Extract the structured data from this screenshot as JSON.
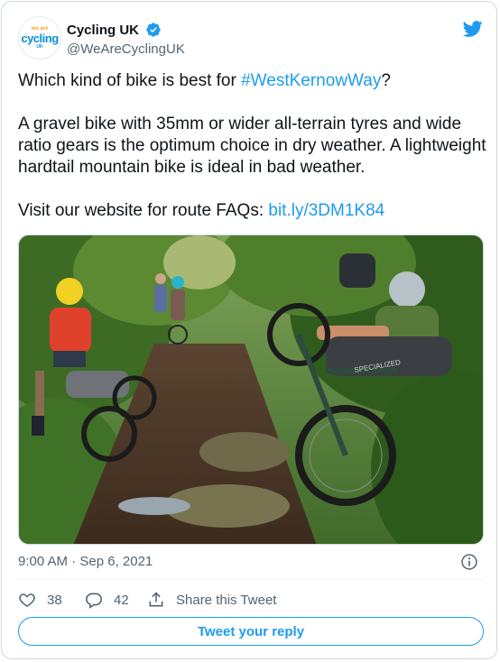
{
  "author": {
    "display_name": "Cycling UK",
    "handle": "@WeAreCyclingUK",
    "avatar": {
      "top": "we are",
      "main": "cycling",
      "bottom": "UK"
    },
    "verified": true
  },
  "tweet": {
    "line1_prefix": "Which kind of bike is best for ",
    "hashtag": "#WestKernowWay",
    "line1_suffix": "?",
    "paragraph2": "A gravel bike with 35mm or wider all-terrain tyres and wide ratio gears is the optimum choice in dry weather. A lightweight hardtail mountain bike is ideal in bad weather.",
    "line3_prefix": "Visit our website for route FAQs: ",
    "url": "bit.ly/3DM1K84"
  },
  "media_frame": {
    "frame_text": "SPECIALIZED"
  },
  "meta": {
    "timestamp": "9:00 AM · Sep 6, 2021"
  },
  "actions": {
    "likes": "38",
    "replies": "42",
    "share_label": "Share this Tweet"
  },
  "reply_button": "Tweet your reply",
  "colors": {
    "accent": "#1d9bf0",
    "text": "#0f1419",
    "muted": "#536471",
    "border": "#cfd9de"
  }
}
